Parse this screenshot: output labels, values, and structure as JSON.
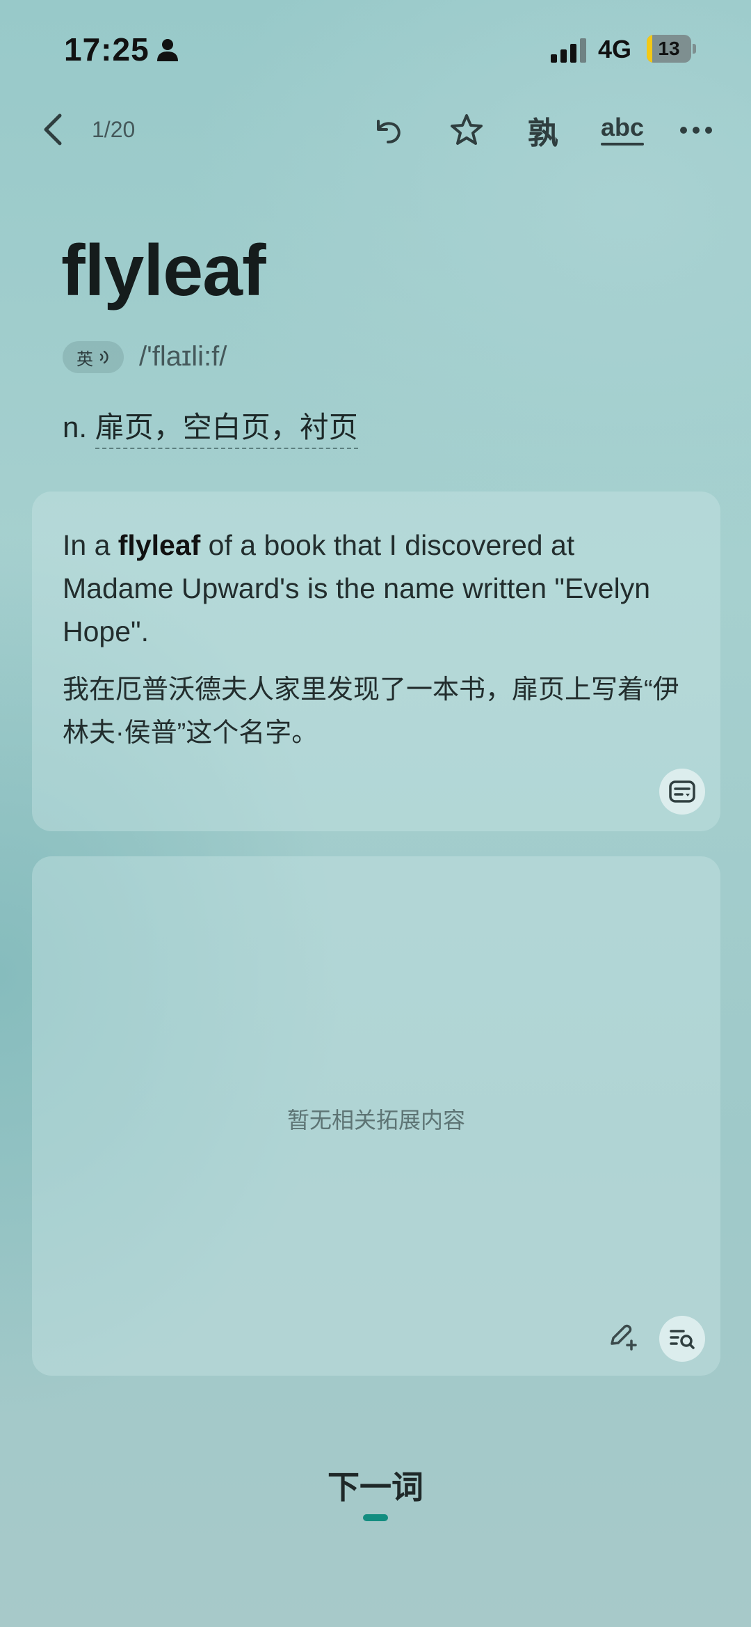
{
  "status_bar": {
    "time": "17:25",
    "network": "4G",
    "battery_level": "13",
    "icons": [
      "person-icon",
      "signal-icon",
      "battery-icon"
    ]
  },
  "nav": {
    "counter": "1/20",
    "familiar_label": "孰",
    "spell_label": "abc",
    "icons": [
      "back-icon",
      "undo-icon",
      "star-icon",
      "more-icon"
    ]
  },
  "word": {
    "headword": "flyleaf",
    "accent": "英",
    "phonetic": "/'flaɪli:f/",
    "pos": "n.",
    "meaning": "扉页，空白页，衬页"
  },
  "example": {
    "en_before": "In a ",
    "en_keyword": "flyleaf",
    "en_after": " of a book that I discovered at Madame Upward's is the name written \"Evelyn Hope\".",
    "zh": "我在厄普沃德夫人家里发现了一本书，扉页上写着“伊林夫·侯普”这个名字。"
  },
  "extension": {
    "empty_text": "暂无相关拓展内容"
  },
  "footer": {
    "next_label": "下一词",
    "accent_color": "#138d80"
  }
}
